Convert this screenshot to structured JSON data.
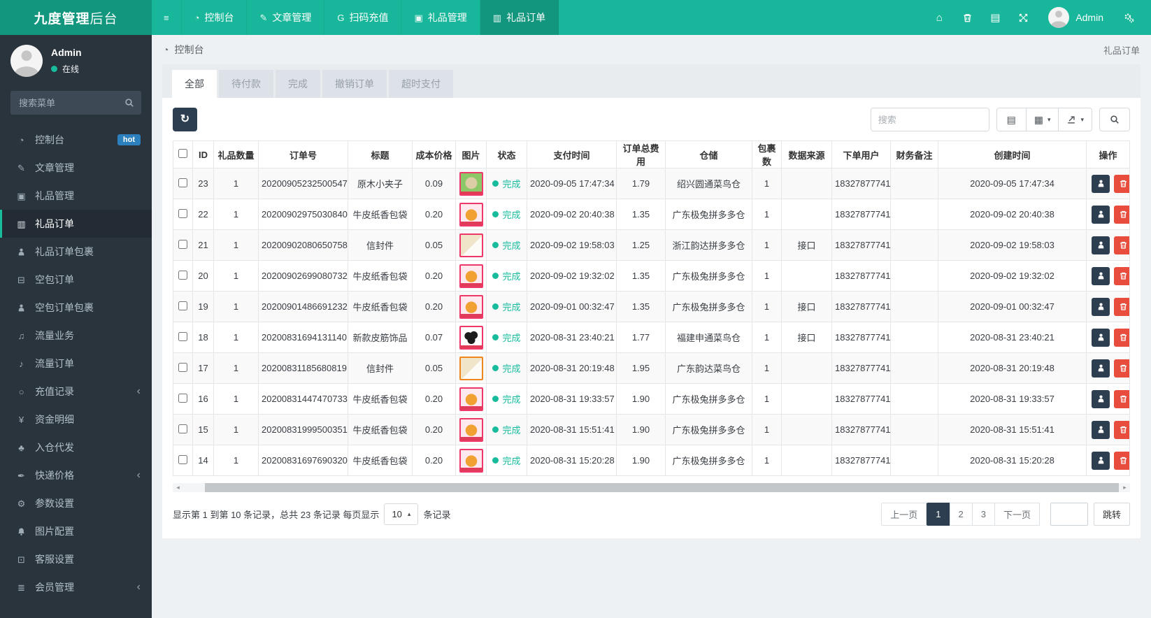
{
  "colors": {
    "navbar_teal": "#18b69a",
    "navbar_dark_teal": "#12977e",
    "sidebar_bg": "#2a343d",
    "accent_green": "#18bc9c",
    "navy": "#2c3e50",
    "danger_red": "#e74c3c",
    "hot_badge_blue": "#2b80bd"
  },
  "navbar": {
    "brand_bold": "九度管理",
    "brand_light": "后台",
    "hamburger_icon": "hamburger",
    "items": [
      {
        "key": "dashboard",
        "icon": "gauge",
        "label": "控制台"
      },
      {
        "key": "articles",
        "icon": "pencil",
        "label": "文章管理"
      },
      {
        "key": "scan-recharge",
        "icon": "letter-g",
        "label": "扫码充值"
      },
      {
        "key": "gifts",
        "icon": "cube",
        "label": "礼品管理"
      },
      {
        "key": "gift-orders",
        "icon": "truck",
        "label": "礼品订单",
        "active": true
      }
    ],
    "right_icons": [
      {
        "key": "home",
        "icon": "home"
      },
      {
        "key": "clear-trash",
        "icon": "trash"
      },
      {
        "key": "log",
        "icon": "log"
      },
      {
        "key": "fullscreen",
        "icon": "expand"
      }
    ],
    "user": "Admin",
    "settings_icon": "gears"
  },
  "sidebar": {
    "user_name": "Admin",
    "user_status": "在线",
    "search_placeholder": "搜索菜单",
    "items": [
      {
        "key": "dashboard",
        "icon": "gauge",
        "label": "控制台",
        "badge": "hot"
      },
      {
        "key": "articles",
        "icon": "pencil",
        "label": "文章管理"
      },
      {
        "key": "gifts",
        "icon": "cube",
        "label": "礼品管理"
      },
      {
        "key": "gift-orders",
        "icon": "truck",
        "label": "礼品订单",
        "active": true
      },
      {
        "key": "gift-order-packages",
        "icon": "child",
        "label": "礼品订单包裹"
      },
      {
        "key": "empty-orders",
        "icon": "archive",
        "label": "空包订单"
      },
      {
        "key": "empty-order-packages",
        "icon": "user",
        "label": "空包订单包裹"
      },
      {
        "key": "traffic-business",
        "icon": "music",
        "label": "流量业务"
      },
      {
        "key": "traffic-orders",
        "icon": "music2",
        "label": "流量订单"
      },
      {
        "key": "recharge-records",
        "icon": "circle",
        "label": "充值记录",
        "chevron": true
      },
      {
        "key": "fund-details",
        "icon": "yen",
        "label": "资金明细"
      },
      {
        "key": "warehouse-dropship",
        "icon": "cubes",
        "label": "入仓代发"
      },
      {
        "key": "express-prices",
        "icon": "quill",
        "label": "快递价格",
        "chevron": true
      },
      {
        "key": "parameter-settings",
        "icon": "gear",
        "label": "参数设置"
      },
      {
        "key": "image-config",
        "icon": "bell",
        "label": "图片配置"
      },
      {
        "key": "service-settings",
        "icon": "tie",
        "label": "客服设置"
      },
      {
        "key": "member-management",
        "icon": "list",
        "label": "会员管理",
        "chevron": true
      }
    ]
  },
  "breadcrumb": {
    "icon": "gauge",
    "label": "控制台"
  },
  "page_title": "礼品订单",
  "tabs": [
    {
      "key": "all",
      "label": "全部",
      "active": true
    },
    {
      "key": "pending-payment",
      "label": "待付款"
    },
    {
      "key": "completed",
      "label": "完成"
    },
    {
      "key": "cancelled-orders",
      "label": "撤销订单"
    },
    {
      "key": "overtime-payment",
      "label": "超时支付"
    }
  ],
  "toolbar": {
    "refresh_icon": "refresh",
    "search_placeholder": "搜索",
    "buttons": [
      {
        "key": "detail-view",
        "icon": "list-alt"
      },
      {
        "key": "columns",
        "icon": "grid",
        "caret": true
      },
      {
        "key": "export",
        "icon": "export",
        "caret": true
      }
    ],
    "search_button_icon": "search"
  },
  "table": {
    "columns": [
      {
        "key": "check",
        "label": ""
      },
      {
        "key": "id",
        "label": "ID"
      },
      {
        "key": "qty",
        "label": "礼品数量"
      },
      {
        "key": "order_no",
        "label": "订单号"
      },
      {
        "key": "title",
        "label": "标题"
      },
      {
        "key": "cost",
        "label": "成本价格"
      },
      {
        "key": "thumb",
        "label": "图片"
      },
      {
        "key": "status",
        "label": "状态"
      },
      {
        "key": "pay_time",
        "label": "支付时间"
      },
      {
        "key": "total",
        "label": "订单总费用"
      },
      {
        "key": "warehouse",
        "label": "仓储"
      },
      {
        "key": "packages",
        "label": "包裹数"
      },
      {
        "key": "source",
        "label": "数据来源"
      },
      {
        "key": "user",
        "label": "下单用户"
      },
      {
        "key": "note",
        "label": "财务备注"
      },
      {
        "key": "created",
        "label": "创建时间"
      },
      {
        "key": "actions",
        "label": "操作"
      }
    ],
    "rows": [
      {
        "id": "23",
        "qty": "1",
        "order_no": "20200905232500547",
        "title": "原木小夹子",
        "cost": "0.09",
        "thumb": "clips",
        "status": "完成",
        "pay_time": "2020-09-05 17:47:34",
        "total": "1.79",
        "warehouse": "绍兴圆通菜鸟仓",
        "packages": "1",
        "source": "",
        "user": "18327877741",
        "note": "",
        "created": "2020-09-05 17:47:34"
      },
      {
        "id": "22",
        "qty": "1",
        "order_no": "20200902975030840",
        "title": "牛皮纸香包袋",
        "cost": "0.20",
        "thumb": "bag",
        "status": "完成",
        "pay_time": "2020-09-02 20:40:38",
        "total": "1.35",
        "warehouse": "广东极兔拼多多仓",
        "packages": "1",
        "source": "",
        "user": "18327877741",
        "note": "",
        "created": "2020-09-02 20:40:38"
      },
      {
        "id": "21",
        "qty": "1",
        "order_no": "20200902080650758",
        "title": "信封件",
        "cost": "0.05",
        "thumb": "envelope",
        "status": "完成",
        "pay_time": "2020-09-02 19:58:03",
        "total": "1.25",
        "warehouse": "浙江韵达拼多多仓",
        "packages": "1",
        "source": "接口",
        "user": "18327877741",
        "note": "",
        "created": "2020-09-02 19:58:03"
      },
      {
        "id": "20",
        "qty": "1",
        "order_no": "20200902699080732",
        "title": "牛皮纸香包袋",
        "cost": "0.20",
        "thumb": "bag",
        "status": "完成",
        "pay_time": "2020-09-02 19:32:02",
        "total": "1.35",
        "warehouse": "广东极兔拼多多仓",
        "packages": "1",
        "source": "",
        "user": "18327877741",
        "note": "",
        "created": "2020-09-02 19:32:02"
      },
      {
        "id": "19",
        "qty": "1",
        "order_no": "20200901486691232",
        "title": "牛皮纸香包袋",
        "cost": "0.20",
        "thumb": "bag",
        "status": "完成",
        "pay_time": "2020-09-01 00:32:47",
        "total": "1.35",
        "warehouse": "广东极兔拼多多仓",
        "packages": "1",
        "source": "接口",
        "user": "18327877741",
        "note": "",
        "created": "2020-09-01 00:32:47"
      },
      {
        "id": "18",
        "qty": "1",
        "order_no": "20200831694131140",
        "title": "新款皮筋饰品",
        "cost": "0.07",
        "thumb": "bands",
        "status": "完成",
        "pay_time": "2020-08-31 23:40:21",
        "total": "1.77",
        "warehouse": "福建申通菜鸟仓",
        "packages": "1",
        "source": "接口",
        "user": "18327877741",
        "note": "",
        "created": "2020-08-31 23:40:21"
      },
      {
        "id": "17",
        "qty": "1",
        "order_no": "20200831185680819",
        "title": "信封件",
        "cost": "0.05",
        "thumb": "envelope2",
        "status": "完成",
        "pay_time": "2020-08-31 20:19:48",
        "total": "1.95",
        "warehouse": "广东韵达菜鸟仓",
        "packages": "1",
        "source": "",
        "user": "18327877741",
        "note": "",
        "created": "2020-08-31 20:19:48"
      },
      {
        "id": "16",
        "qty": "1",
        "order_no": "20200831447470733",
        "title": "牛皮纸香包袋",
        "cost": "0.20",
        "thumb": "bag",
        "status": "完成",
        "pay_time": "2020-08-31 19:33:57",
        "total": "1.90",
        "warehouse": "广东极兔拼多多仓",
        "packages": "1",
        "source": "",
        "user": "18327877741",
        "note": "",
        "created": "2020-08-31 19:33:57"
      },
      {
        "id": "15",
        "qty": "1",
        "order_no": "20200831999500351",
        "title": "牛皮纸香包袋",
        "cost": "0.20",
        "thumb": "bag",
        "status": "完成",
        "pay_time": "2020-08-31 15:51:41",
        "total": "1.90",
        "warehouse": "广东极兔拼多多仓",
        "packages": "1",
        "source": "",
        "user": "18327877741",
        "note": "",
        "created": "2020-08-31 15:51:41"
      },
      {
        "id": "14",
        "qty": "1",
        "order_no": "20200831697690320",
        "title": "牛皮纸香包袋",
        "cost": "0.20",
        "thumb": "bag",
        "status": "完成",
        "pay_time": "2020-08-31 15:20:28",
        "total": "1.90",
        "warehouse": "广东极兔拼多多仓",
        "packages": "1",
        "source": "",
        "user": "18327877741",
        "note": "",
        "created": "2020-08-31 15:20:28"
      }
    ]
  },
  "pagination": {
    "info": "显示第 1 到第 10 条记录，总共 23 条记录 每页显示",
    "page_size": "10",
    "info_suffix": "条记录",
    "prev_label": "上一页",
    "pages": [
      "1",
      "2",
      "3"
    ],
    "active_page": "1",
    "next_label": "下一页",
    "jump_label": "跳转",
    "jump_value": ""
  }
}
